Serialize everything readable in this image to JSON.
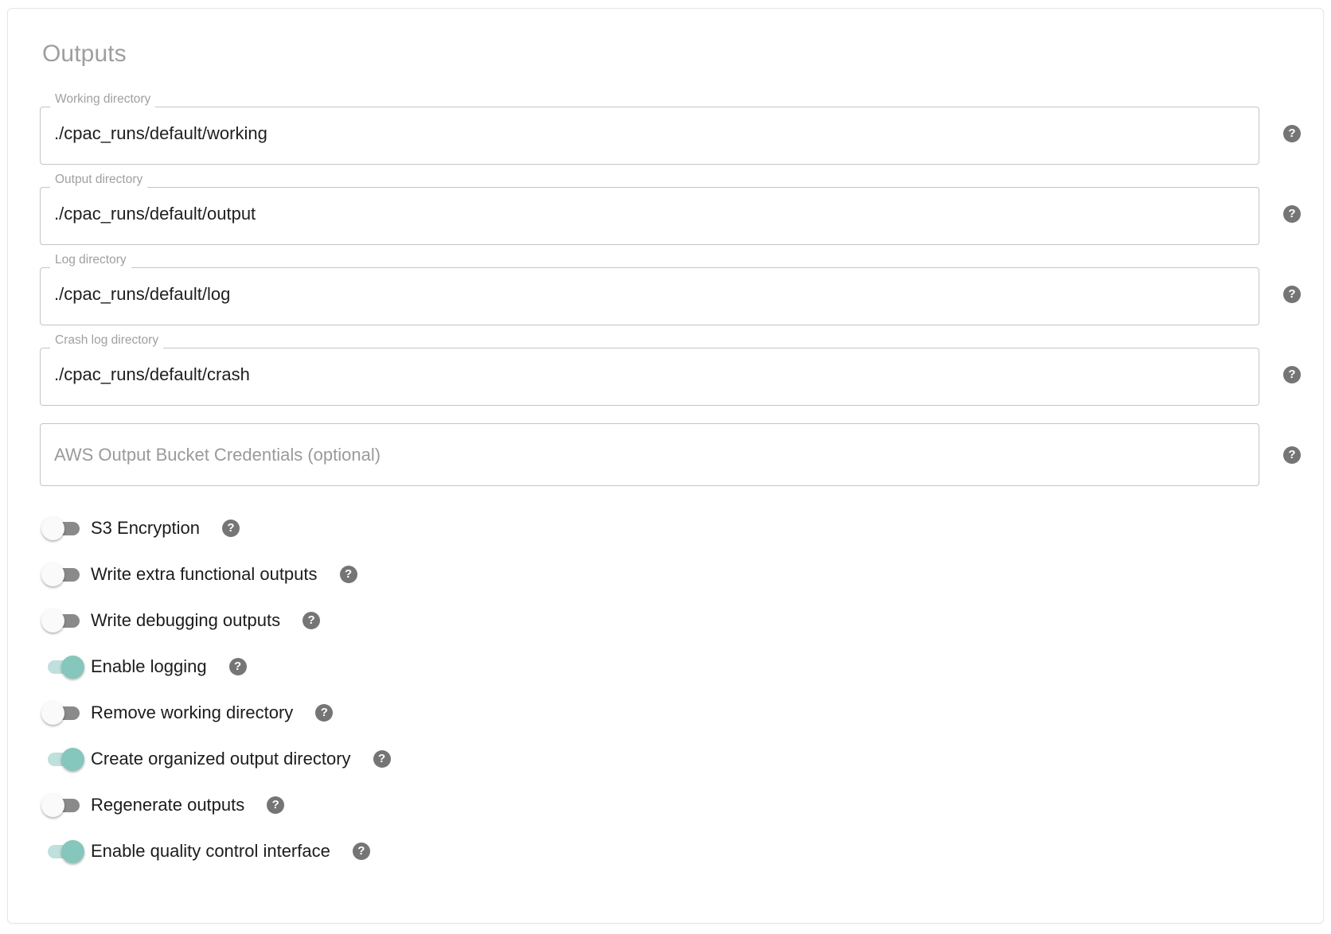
{
  "section": {
    "title": "Outputs"
  },
  "help_icon_glyph": "?",
  "help_icon_name": "help-circle-icon",
  "colors": {
    "title": "#9e9e9e",
    "field_border": "#c4c4c4",
    "field_label": "#a0a0a0",
    "toggle_off_track": "#8a8a8a",
    "toggle_off_knob": "#fafafa",
    "toggle_on_track": "#bfe0dc",
    "toggle_on_knob": "#85c6bd",
    "help_icon_bg": "#757575",
    "card_border": "#e6e6e6"
  },
  "fields": [
    {
      "name": "working-directory",
      "label": "Working directory",
      "value": "./cpac_runs/default/working",
      "placeholder": "",
      "has_label": true
    },
    {
      "name": "output-directory",
      "label": "Output directory",
      "value": "./cpac_runs/default/output",
      "placeholder": "",
      "has_label": true
    },
    {
      "name": "log-directory",
      "label": "Log directory",
      "value": "./cpac_runs/default/log",
      "placeholder": "",
      "has_label": true
    },
    {
      "name": "crash-log-directory",
      "label": "Crash log directory",
      "value": "./cpac_runs/default/crash",
      "placeholder": "",
      "has_label": true
    },
    {
      "name": "aws-output-bucket-credentials",
      "label": "",
      "value": "",
      "placeholder": "AWS Output Bucket Credentials (optional)",
      "has_label": false
    }
  ],
  "toggles": [
    {
      "name": "s3-encryption",
      "label": "S3 Encryption",
      "on": false
    },
    {
      "name": "write-extra-functional-outputs",
      "label": "Write extra functional outputs",
      "on": false
    },
    {
      "name": "write-debugging-outputs",
      "label": "Write debugging outputs",
      "on": false
    },
    {
      "name": "enable-logging",
      "label": "Enable logging",
      "on": true
    },
    {
      "name": "remove-working-directory",
      "label": "Remove working directory",
      "on": false
    },
    {
      "name": "create-organized-output-directory",
      "label": "Create organized output directory",
      "on": true
    },
    {
      "name": "regenerate-outputs",
      "label": "Regenerate outputs",
      "on": false
    },
    {
      "name": "enable-quality-control-interface",
      "label": "Enable quality control interface",
      "on": true
    }
  ]
}
